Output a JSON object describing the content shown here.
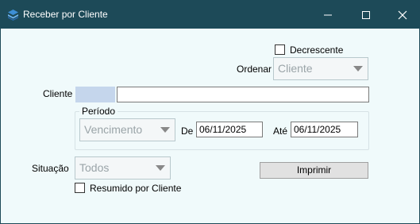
{
  "window": {
    "title": "Receber por Cliente",
    "icon": "app-stack-icon",
    "controls": [
      "minimize-icon",
      "maximize-icon",
      "close-icon"
    ]
  },
  "form": {
    "decrescente_label": "Decrescente",
    "decrescente_checked": false,
    "ordenar_label": "Ordenar",
    "ordenar_value": "Cliente",
    "cliente_label": "Cliente",
    "cliente_code": "",
    "cliente_name": "",
    "periodo_label": "Período",
    "periodo_value": "Vencimento",
    "de_label": "De",
    "de_value": "06/11/2025",
    "ate_label": "Até",
    "ate_value": "06/11/2025",
    "situacao_label": "Situação",
    "situacao_value": "Todos",
    "imprimir_label": "Imprimir",
    "resumido_label": "Resumido por Cliente",
    "resumido_checked": false
  },
  "colors": {
    "titlebar": "#1d4a58",
    "background": "#f0fafb",
    "code_highlight": "#c5d6ec"
  }
}
